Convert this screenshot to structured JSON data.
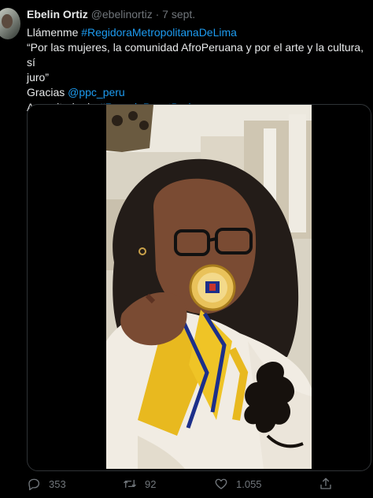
{
  "tweet": {
    "author_name": "Ebelin Ortiz",
    "handle": "@ebelinortiz",
    "separator": "·",
    "date": "7 sept.",
    "line1_prefix": "Llámenme ",
    "hashtag1": "#RegidoraMetropolitanaDeLima",
    "line2": "“Por las mujeres, la comunidad AfroPeruana y por el arte y la cultura, sí",
    "line3": "juro”",
    "line4_prefix": "Gracias ",
    "mention": "@ppc_peru",
    "line5_prefix": "Accesitaria de ",
    "hashtag2": "#RosarioPayetBedoya"
  },
  "actions": {
    "replies": "353",
    "retweets": "92",
    "likes": "1.055"
  },
  "icons": {
    "reply": "reply-icon",
    "retweet": "retweet-icon",
    "like": "like-icon",
    "share": "share-icon"
  },
  "colors": {
    "background": "#000000",
    "text": "#e7e9ea",
    "muted": "#71767b",
    "link": "#1d9bf0",
    "border": "#2f3336"
  }
}
